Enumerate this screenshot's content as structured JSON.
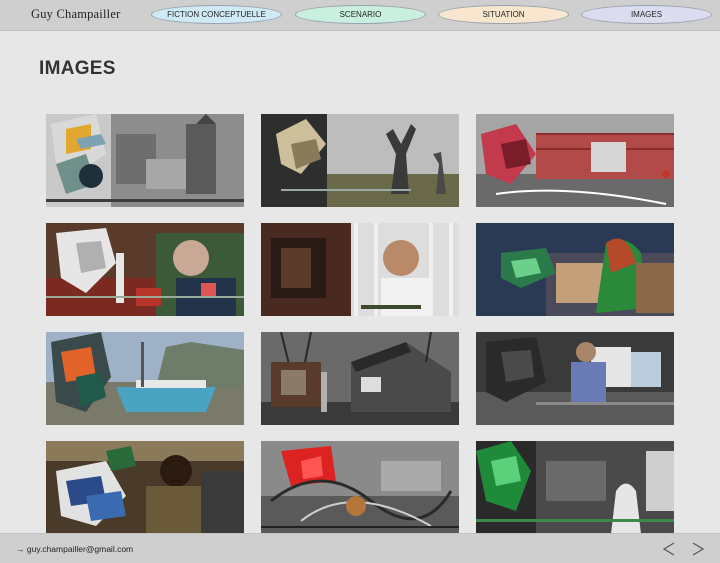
{
  "header": {
    "site_title": "Guy Champailler",
    "nav": [
      {
        "label": "FICTION CONCEPTUELLE",
        "color": "#cfe9f5"
      },
      {
        "label": "SCENARIO",
        "color": "#c9f0de"
      },
      {
        "label": "SITUATION",
        "color": "#f8e6cf"
      },
      {
        "label": "IMAGES",
        "color": "#dcdcf1"
      }
    ]
  },
  "main": {
    "page_title": "IMAGES"
  },
  "footer": {
    "email_arrow": "→",
    "email": "guy.champailler@gmail.com",
    "prev_icon": "chevron-left-icon",
    "next_icon": "chevron-right-icon"
  },
  "colors": {
    "header_bg": "#cfcfcf",
    "page_bg": "#e7e7e7",
    "text": "#333333"
  }
}
